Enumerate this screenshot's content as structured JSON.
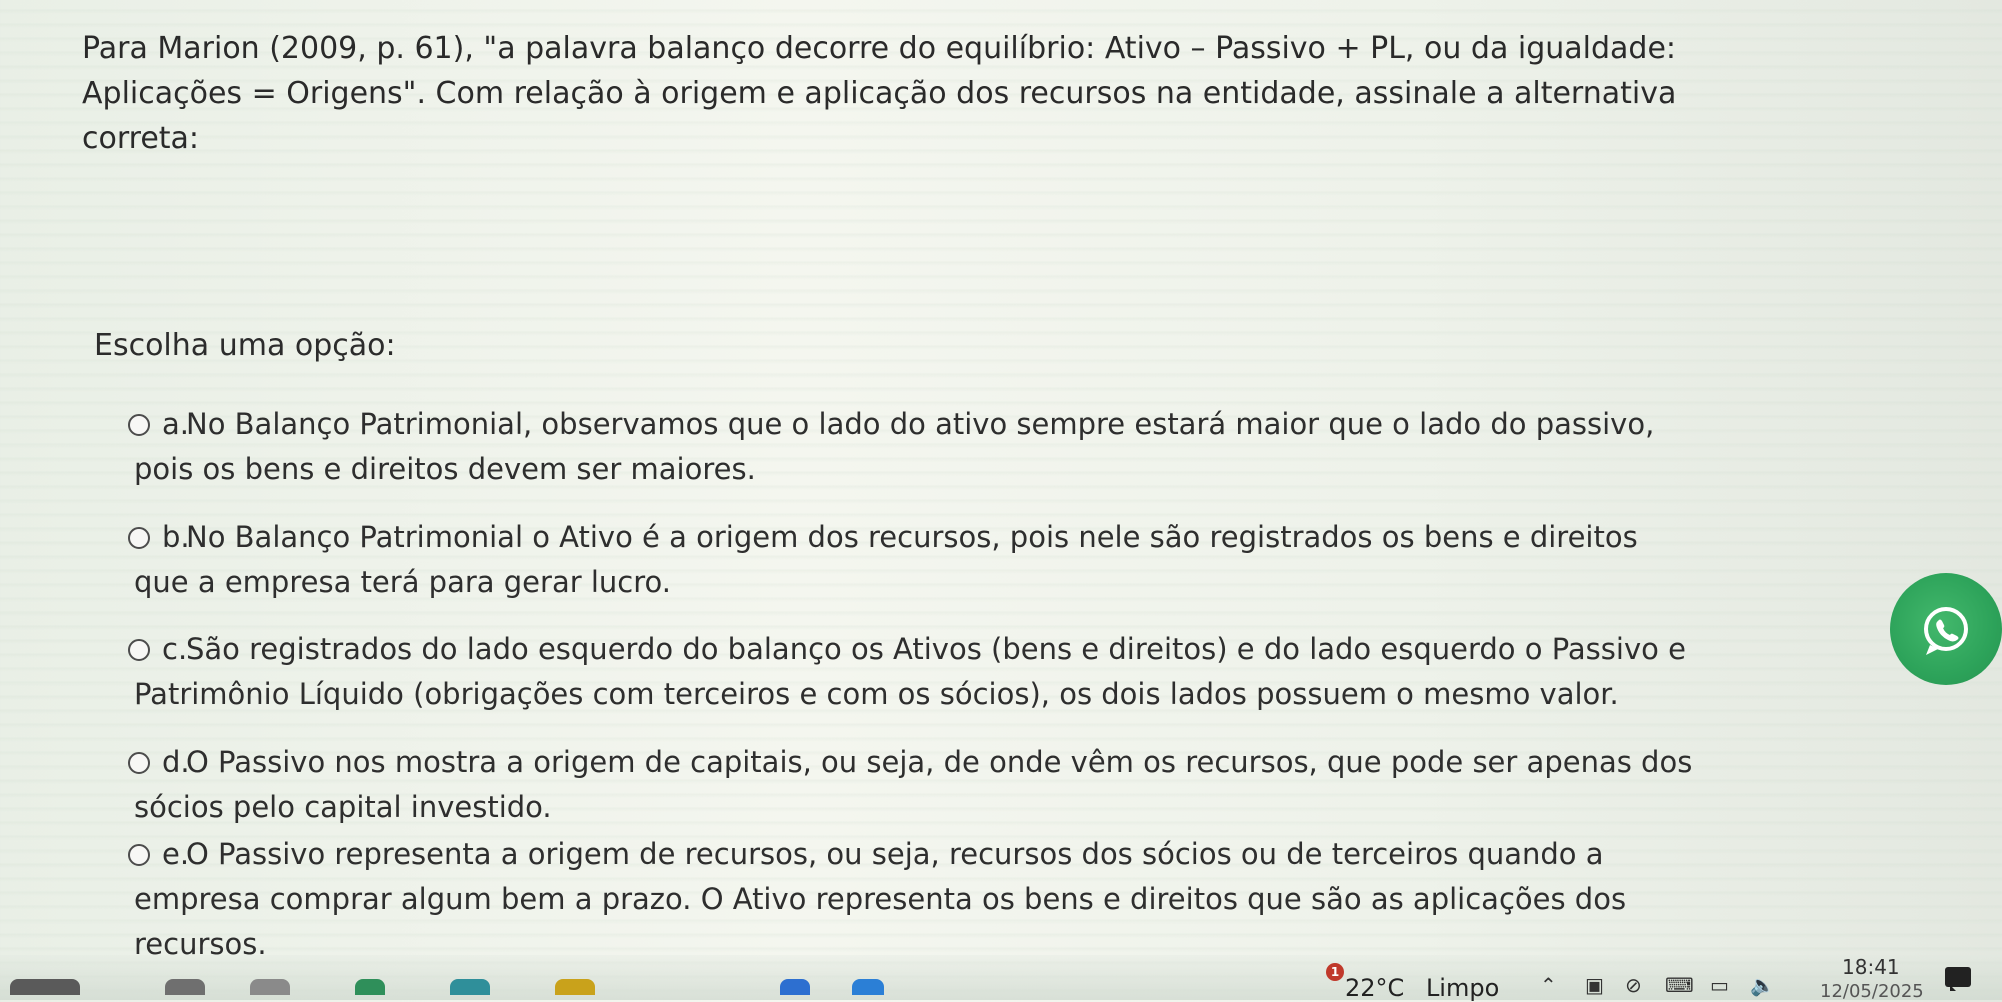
{
  "question": {
    "line1": "Para Marion (2009, p. 61), \"a palavra balanço decorre do equilíbrio: Ativo – Passivo + PL, ou da igualdade:",
    "line2": "Aplicações = Origens\". Com relação à origem e aplicação dos recursos na entidade, assinale a alternativa",
    "line3": "correta:"
  },
  "prompt": "Escolha uma opção:",
  "options": [
    {
      "letter": "a.",
      "line1": "No Balanço Patrimonial, observamos que o lado do ativo sempre estará maior que o lado do passivo,",
      "line2": "pois os bens e direitos devem ser maiores."
    },
    {
      "letter": "b.",
      "line1": "No Balanço Patrimonial o Ativo é a origem dos recursos, pois nele são registrados os bens e direitos",
      "line2": "que a empresa terá para gerar lucro."
    },
    {
      "letter": "c.",
      "line1": "São registrados do lado esquerdo do balanço os Ativos (bens e direitos) e do lado esquerdo o Passivo e",
      "line2": "Patrimônio Líquido (obrigações com terceiros e com os sócios), os dois lados possuem o mesmo valor."
    },
    {
      "letter": "d.",
      "line1": "O Passivo nos mostra a origem de capitais, ou seja, de onde vêm os recursos, que pode ser apenas dos",
      "line2": "sócios pelo capital investido."
    },
    {
      "letter": "e.",
      "line1": "O Passivo representa a origem de recursos, ou seja, recursos dos sócios ou de terceiros quando a",
      "line2": "empresa comprar algum bem a prazo. O Ativo representa os bens e direitos que são as aplicações dos",
      "line3": "recursos."
    }
  ],
  "taskbar": {
    "weather_temp": "22°C",
    "weather_cond": "Limpo",
    "alert_count": "1",
    "time": "18:41",
    "date": "12/05/2025"
  },
  "icons": {
    "chat": "whatsapp-icon",
    "tray": [
      "chevron-up-icon",
      "camera-icon",
      "cloud-off-icon",
      "keyboard-icon",
      "monitor-icon",
      "speaker-icon"
    ]
  },
  "colors": {
    "chat_button": "#2da35a",
    "alert": "#c0392b"
  }
}
